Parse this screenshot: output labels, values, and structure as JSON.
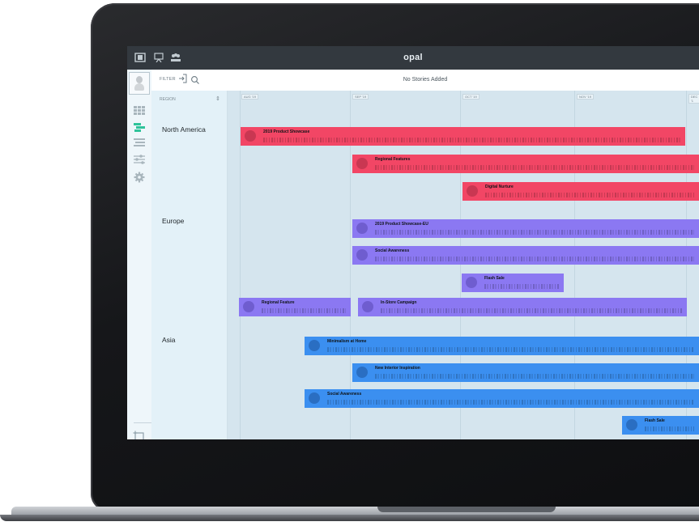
{
  "app": {
    "title": "opal"
  },
  "topbar": {
    "icons": [
      "panel-toggle-icon",
      "presentation-icon",
      "team-icon"
    ]
  },
  "sidebar": {
    "items": [
      {
        "icon": "grid-icon"
      },
      {
        "icon": "timeline-icon"
      },
      {
        "icon": "list-icon"
      },
      {
        "icon": "sliders-icon"
      },
      {
        "icon": "gear-icon"
      }
    ],
    "bottom_items": [
      {
        "icon": "add-story-icon"
      },
      {
        "icon": "settings-cogs-icon"
      }
    ]
  },
  "filterbar": {
    "filter_label": "FILTER",
    "status": "No Stories Added"
  },
  "region_column": {
    "header": "REGION",
    "regions": [
      "North America",
      "Europe",
      "Asia"
    ]
  },
  "timeline": {
    "months": [
      "AUG '19",
      "SEP '19",
      "OCT '19",
      "NOV '19",
      "DEC '1"
    ]
  },
  "stories": [
    {
      "title": "2019 Product Showcase",
      "region": "North America",
      "color": "#f24665"
    },
    {
      "title": "Regional Features",
      "region": "North America",
      "color": "#f24665"
    },
    {
      "title": "Digital Nurture",
      "region": "North America",
      "color": "#f24665"
    },
    {
      "title": "2019 Product Showcase-EU",
      "region": "Europe",
      "color": "#8b78f2"
    },
    {
      "title": "Social Awareness",
      "region": "Europe",
      "color": "#8b78f2"
    },
    {
      "title": "Flash Sale",
      "region": "Europe",
      "color": "#8b78f2"
    },
    {
      "title": "Regional Feature",
      "region": "Europe",
      "color": "#8b78f2"
    },
    {
      "title": "In-Store Campaign",
      "region": "Europe",
      "color": "#8b78f2"
    },
    {
      "title": "Minimalism at Home",
      "region": "Asia",
      "color": "#3b8ff0"
    },
    {
      "title": "New Interior Inspiration",
      "region": "Asia",
      "color": "#3b8ff0"
    },
    {
      "title": "Social Awareness",
      "region": "Asia",
      "color": "#3b8ff0"
    },
    {
      "title": "Flash Sale",
      "region": "Asia",
      "color": "#3b8ff0"
    }
  ]
}
